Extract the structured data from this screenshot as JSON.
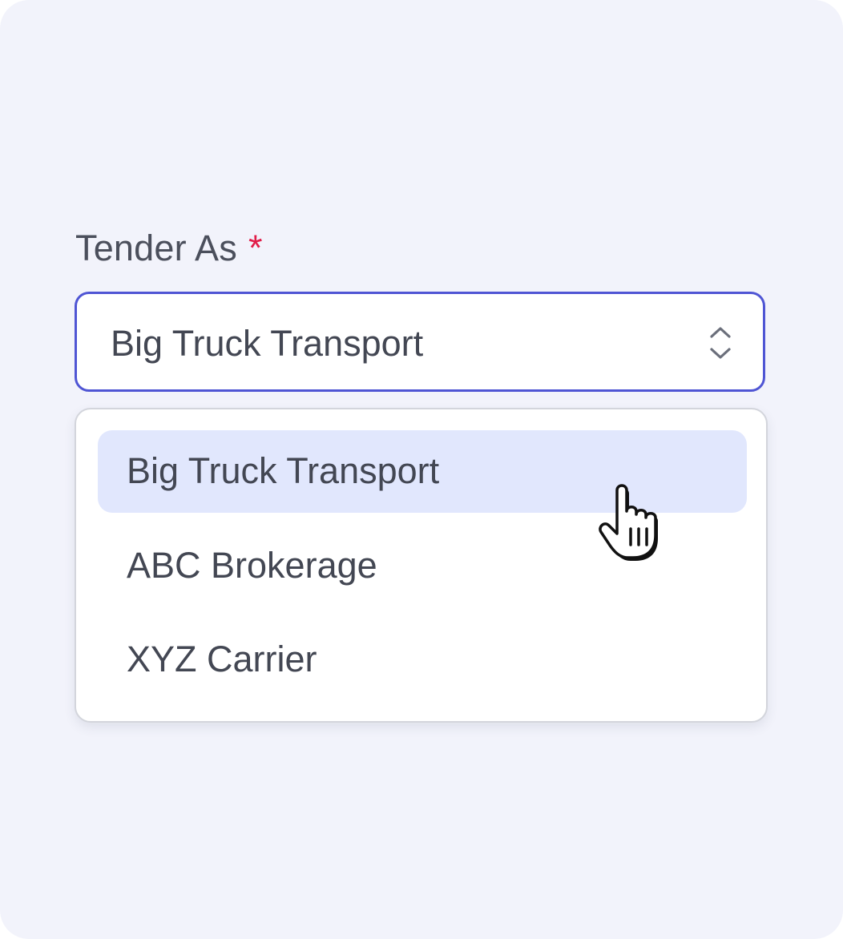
{
  "field": {
    "label": "Tender As",
    "required_mark": "*",
    "selected_value": "Big Truck Transport"
  },
  "dropdown": {
    "options": [
      {
        "label": "Big Truck Transport",
        "highlighted": true
      },
      {
        "label": "ABC Brokerage",
        "highlighted": false
      },
      {
        "label": "XYZ Carrier",
        "highlighted": false
      }
    ]
  },
  "icons": {
    "select_toggle": "chevron-up-down-icon",
    "cursor": "hand-pointer-cursor-icon"
  },
  "colors": {
    "focus_border": "#4f55d4",
    "required": "#e11d48",
    "highlight": "#e1e7fd",
    "background": "#f2f3fb"
  }
}
